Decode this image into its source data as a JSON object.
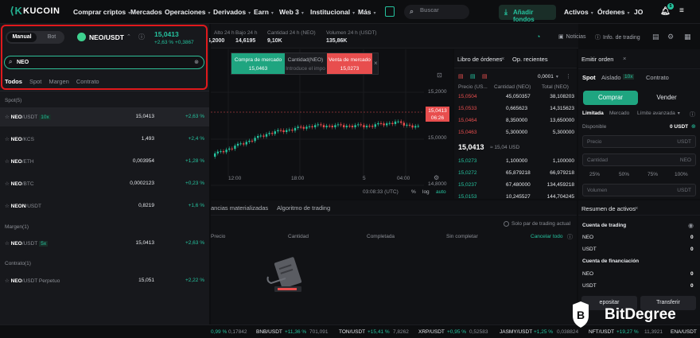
{
  "nav": {
    "logo": "KUCOIN",
    "items": [
      "Comprar criptos",
      "Mercados",
      "Operaciones",
      "Derivados",
      "Earn",
      "Web 3",
      "Institucional",
      "Más"
    ],
    "search_placeholder": "Buscar",
    "add_funds": "Añadir fondos",
    "assets": "Activos",
    "orders": "Órdenes",
    "avatar": "JO",
    "notif_count": "5"
  },
  "pair": {
    "mode_on": "Manual",
    "mode_off": "Bot",
    "symbol": "NEO/USDT",
    "price": "15,0413",
    "change_pct": "+2,63 %",
    "change_abs": "+0,3867"
  },
  "stats": [
    {
      "k": "Alto 24 h",
      "v": "15,2000"
    },
    {
      "k": "Bajo 24 h",
      "v": "14,6195"
    },
    {
      "k": "Cantidad 24 h (NEO)",
      "v": "9,10K"
    },
    {
      "k": "Volumen 24 h (USDT)",
      "v": "135,86K"
    }
  ],
  "toolbar": {
    "news": "Noticias",
    "info": "Info. de trading"
  },
  "search": {
    "value": "NEO"
  },
  "filter_tabs": [
    "Todos",
    "Spot",
    "Margen",
    "Contrato"
  ],
  "sections": {
    "spot": "Spot(5)",
    "margin": "Margen(1)",
    "contract": "Contrato(1)"
  },
  "markets": [
    {
      "base": "NEO",
      "quote": "/USDT",
      "lev": "10x",
      "price": "15,0413",
      "chg": "+2,63 %"
    },
    {
      "base": "NEO",
      "quote": "/KCS",
      "lev": "",
      "price": "1,493",
      "chg": "+2,4 %"
    },
    {
      "base": "NEO",
      "quote": "/ETH",
      "lev": "",
      "price": "0,003954",
      "chg": "+1,28 %"
    },
    {
      "base": "NEO",
      "quote": "/BTC",
      "lev": "",
      "price": "0,0002123",
      "chg": "+0,23 %"
    },
    {
      "base": "NEON",
      "quote": "/USDT",
      "lev": "",
      "price": "0,8219",
      "chg": "+1,6 %"
    }
  ],
  "margin_markets": [
    {
      "base": "NEO",
      "quote": "/USDT",
      "lev": "5x",
      "price": "15,0413",
      "chg": "+2,63 %"
    }
  ],
  "contract_markets": [
    {
      "base": "NEO",
      "quote": "/USDT Perpetuo",
      "lev": "",
      "price": "15,051",
      "chg": "+2,22 %"
    }
  ],
  "popup": {
    "buy_label": "Compra de mercado",
    "buy_price": "15,0463",
    "qty_label": "Cantidad(NEO)",
    "qty_placeholder": "Introduce el impo",
    "sell_label": "Venta de mercado",
    "sell_price": "15,0273"
  },
  "chart": {
    "y_ticks": [
      "15,2000",
      "15,0000",
      "14,8000",
      "14,6000"
    ],
    "x_ticks": [
      "12:00",
      "18:00",
      "5",
      "04:00"
    ],
    "last_price": "15,0413",
    "countdown": "06:26",
    "time": "03:08:33 (UTC)",
    "opts": [
      "%",
      "log",
      "auto"
    ]
  },
  "book": {
    "title": "Libro de órdenes",
    "tab2": "Op. recientes",
    "precision": "0,0001",
    "cols": [
      "Precio (US...",
      "Cantidad (NEO)",
      "Total (NEO)"
    ],
    "asks": [
      {
        "p": "15,0504",
        "q": "45,050357",
        "t": "38,108203"
      },
      {
        "p": "15,0533",
        "q": "0,665623",
        "t": "14,315623"
      },
      {
        "p": "15,0464",
        "q": "8,350000",
        "t": "13,650000"
      },
      {
        "p": "15,0463",
        "q": "5,300000",
        "t": "5,300000"
      }
    ],
    "mid": "15,0413",
    "mid_usd": "≈ 15,04 USD",
    "bids": [
      {
        "p": "15,0273",
        "q": "1,100000",
        "t": "1,100000"
      },
      {
        "p": "15,0272",
        "q": "65,879218",
        "t": "66,979218"
      },
      {
        "p": "15,0237",
        "q": "67,480000",
        "t": "134,459218"
      },
      {
        "p": "15,0153",
        "q": "10,245527",
        "t": "144,704245"
      }
    ]
  },
  "order": {
    "title": "Emitir orden",
    "tabs": [
      "Spot",
      "Aislado",
      "10x",
      "Contrato"
    ],
    "buy": "Comprar",
    "sell": "Vender",
    "types": [
      "Limitada",
      "Mercado",
      "Límite avanzada"
    ],
    "available_label": "Disponible",
    "available": "0 USDT",
    "price": "Precio",
    "qty": "Cantidad",
    "unit": "USDT",
    "unit_neo": "NEO",
    "pcts": [
      "25%",
      "50%",
      "75%",
      "100%"
    ],
    "volume": "Volumen"
  },
  "bottom": {
    "tabs": [
      "ancias materializadas",
      "Algoritmo de trading"
    ],
    "only_pair": "Solo par de trading actual",
    "cols": [
      "Precio",
      "Cantidad",
      "Completada",
      "Sin completar"
    ],
    "cancel_all": "Cancelar todo"
  },
  "assets": {
    "title": "Resumen de activos",
    "trading": "Cuenta de trading",
    "financing": "Cuenta de financiación",
    "rows": [
      {
        "c": "NEO",
        "v": "0"
      },
      {
        "c": "USDT",
        "v": "0"
      }
    ],
    "rows2": [
      {
        "c": "NEO",
        "v": "0"
      },
      {
        "c": "USDT",
        "v": "0"
      }
    ],
    "deposit": "epositar",
    "transfer": "Transferir"
  },
  "ticker": [
    {
      "t": "0,99 %",
      "v": "0,17842"
    },
    {
      "t": "BNB/USDT",
      "c": "+11,36 %",
      "v": "701,091"
    },
    {
      "t": "TON/USDT",
      "c": "+15,41 %",
      "v": "7,8262"
    },
    {
      "t": "XRP/USDT",
      "c": "+0,95 %",
      "v": "0,52583"
    },
    {
      "t": "JASMY/USDT",
      "c": "+1,25 %",
      "v": "0,038824"
    },
    {
      "t": "NFT/USDT",
      "c": "+19,27 %",
      "v": "11,3921"
    },
    {
      "t": "ENA/USDT"
    }
  ],
  "watermark": "BitDegree"
}
